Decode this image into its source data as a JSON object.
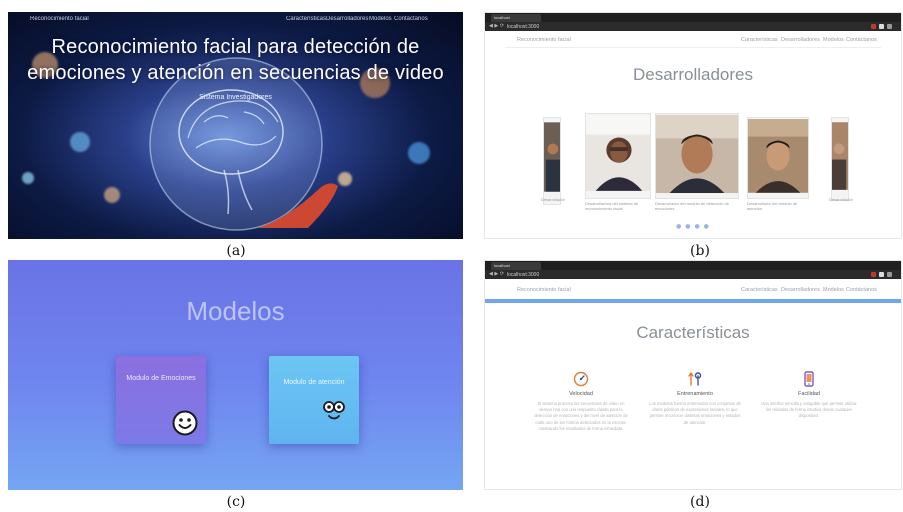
{
  "captions": [
    "(a)",
    "(b)",
    "(c)",
    "(d)"
  ],
  "panel_a": {
    "brand": "Reconocimiento facial",
    "nav": [
      "Características",
      "Desarrolladores",
      "Modelos",
      "Contáctanos"
    ],
    "hero_line1": "Reconocimiento facial para detección de",
    "hero_line2": "emociones y atención en secuencias de video",
    "subtitle": "Sistema Investigadores"
  },
  "panel_b": {
    "tab_title": "localhost",
    "address": "localhost:3000",
    "brand": "Reconocimiento facial",
    "nav": [
      "Características",
      "Desarrolladores",
      "Modelos",
      "Contáctanos"
    ],
    "section_title": "Desarrolladores",
    "cards": [
      {
        "caption": "Desarrollador"
      },
      {
        "caption": "Desarrolladora del sistema de reconocimiento facial"
      },
      {
        "caption": "Desarrollador del módulo de detección de emociones"
      },
      {
        "caption": "Desarrollador del módulo de atención"
      },
      {
        "caption": "Desarrollador"
      }
    ],
    "dots": "● ● ● ●"
  },
  "panel_c": {
    "title": "Modelos",
    "card1_label": "Modulo de Emociones",
    "card2_label": "Modulo de atención"
  },
  "panel_d": {
    "tab_title": "localhost",
    "address": "localhost:3000",
    "brand": "Reconocimiento facial",
    "nav": [
      "Características",
      "Desarrolladores",
      "Modelos",
      "Contáctanos"
    ],
    "section_title": "Características",
    "features": [
      {
        "title": "Velocidad",
        "icon": "speedometer-icon",
        "desc": "El sistema procesa las secuencias de video en tiempo real con una respuesta rápida para la detección de emociones y del nivel de atención de cada uno de los rostros detectados en la escena, mostrando los resultados de forma inmediata."
      },
      {
        "title": "Entrenamiento",
        "icon": "tools-icon",
        "desc": "Los modelos fueron entrenados con conjuntos de datos públicos de expresiones faciales, lo que permite reconocer distintas emociones y estados de atención."
      },
      {
        "title": "Facilidad",
        "icon": "mobile-icon",
        "desc": "Una interfaz sencilla y amigable que permite utilizar los módulos de forma intuitiva desde cualquier dispositivo."
      }
    ]
  },
  "colors": {
    "panel_c_top": "#6a73e5",
    "panel_c_bottom": "#74a6f2",
    "accent_blue": "#6fa7e8"
  }
}
